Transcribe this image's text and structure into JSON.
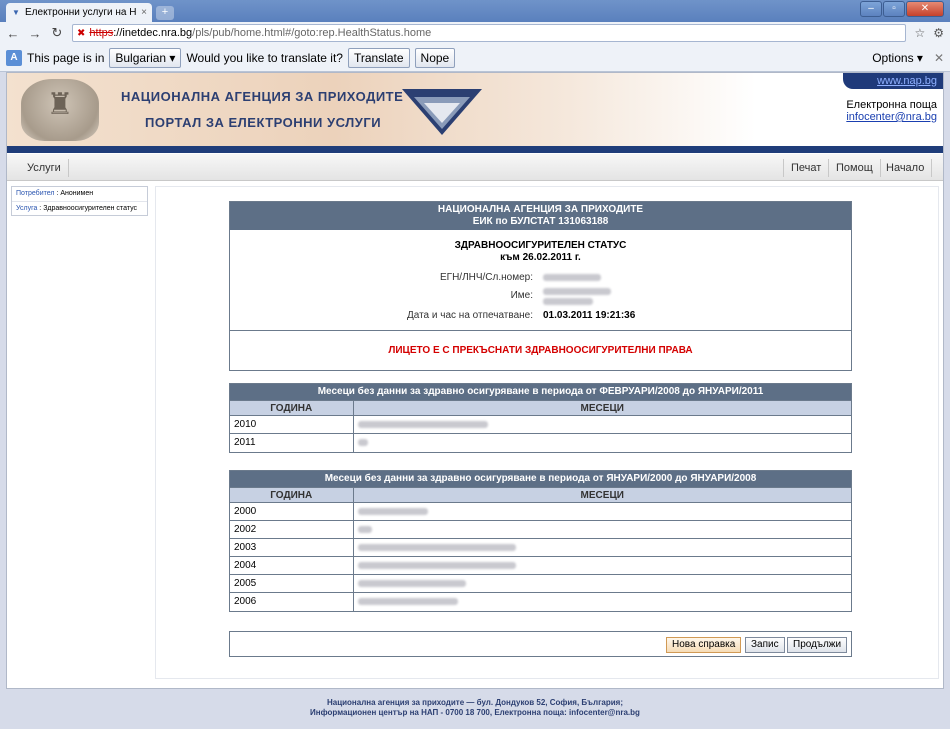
{
  "browser": {
    "tab_title": "Електронни услуги на Н...",
    "tab_close": "×",
    "new_tab": "+",
    "url_scheme": "https",
    "url_host": "://inetdec.nra.bg",
    "url_path": "/pls/pub/home.html#/goto:rep.HealthStatus.home"
  },
  "translate_bar": {
    "text_before": "This page is in",
    "language": "Bulgarian",
    "question": "Would you like to translate it?",
    "translate_label": "Translate",
    "nope_label": "Nope",
    "options_label": "Options"
  },
  "banner": {
    "line1": "НАЦИОНАЛНА АГЕНЦИЯ ЗА ПРИХОДИТЕ",
    "line2": "ПОРТАЛ ЗА ЕЛЕКТРОННИ УСЛУГИ",
    "site_link": "www.nap.bg",
    "email_label": "Електронна поща",
    "email": "infocenter@nra.bg"
  },
  "menu": {
    "services": "Услуги",
    "print": "Печат",
    "help": "Помощ",
    "home": "Начало"
  },
  "sidebar": {
    "user_key": "Потребител",
    "user_value": "Анонимен",
    "service_key": "Услуга",
    "service_value": "Здравноосигурителен статус"
  },
  "report": {
    "agency_line1": "НАЦИОНАЛНА АГЕНЦИЯ ЗА ПРИХОДИТЕ",
    "agency_line2": "ЕИК по БУЛСТАТ 131063188",
    "title_line1": "ЗДРАВНООСИГУРИТЕЛЕН СТАТУС",
    "title_line2": "към 26.02.2011 г.",
    "egn_label": "ЕГН/ЛНЧ/Сл.номер:",
    "name_label": "Име:",
    "printed_label": "Дата и час на отпечатване:",
    "printed_value": "01.03.2011 19:21:36",
    "warning": "ЛИЦЕТО Е С ПРЕКЪСНАТИ ЗДРАВНООСИГУРИТЕЛНИ ПРАВА"
  },
  "table1": {
    "header": "Месеци без данни за здравно осигуряване в периода от ФЕВРУАРИ/2008 до ЯНУАРИ/2011",
    "col_year": "ГОДИНА",
    "col_months": "МЕСЕЦИ",
    "rows": [
      "2010",
      "2011"
    ]
  },
  "table2": {
    "header": "Месеци без данни за здравно осигуряване в периода от ЯНУАРИ/2000 до ЯНУАРИ/2008",
    "col_year": "ГОДИНА",
    "col_months": "МЕСЕЦИ",
    "rows": [
      "2000",
      "2002",
      "2003",
      "2004",
      "2005",
      "2006"
    ]
  },
  "buttons": {
    "new_report": "Нова справка",
    "save": "Запис",
    "continue": "Продължи"
  },
  "footer": {
    "line1": "Национална агенция за приходите — бул. Дондуков 52, София, България;",
    "line2": "Информационен център на НАП - 0700 18 700, Електронна поща: infocenter@nra.bg"
  },
  "colors": {
    "header_bg": "#5d6f86",
    "subheader_bg": "#c7d1e3",
    "warning_text": "#d40000",
    "brand_blue": "#1f3d7a"
  }
}
